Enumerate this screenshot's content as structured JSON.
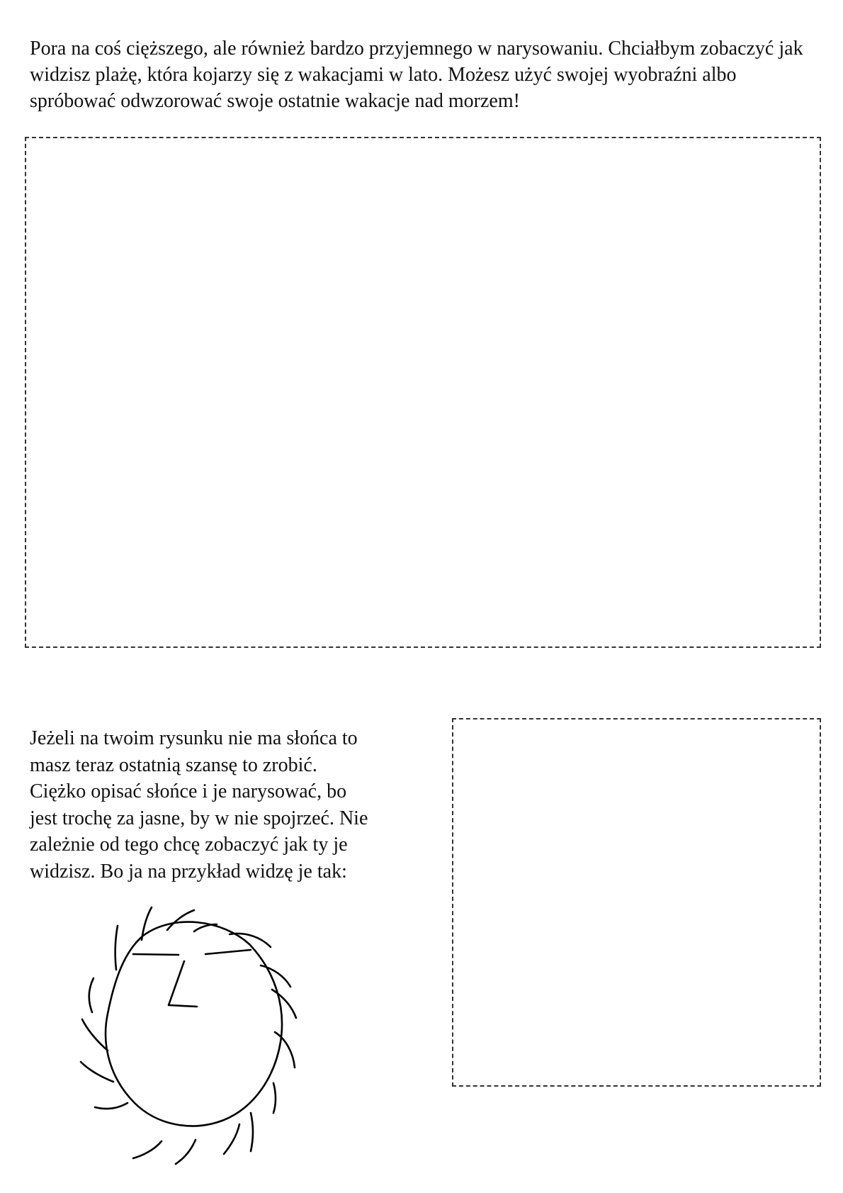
{
  "intro_text": "Pora na coś cięższego, ale również bardzo przyjemnego w narysowaniu. Chciałbym zobaczyć jak widzisz plażę, która kojarzy się z wakacjami w lato. Możesz użyć swojej wyobraźni albo spróbować odwzorować swoje ostatnie wakacje nad morzem!",
  "sun_text_lines": [
    "Jeżeli na twoim rysunku nie ma słońca to",
    "masz teraz ostatnią szansę to zrobić.",
    "Ciężko opisać słońce i je narysować, bo",
    "jest trochę za jasne, by w nie spojrzeć. Nie",
    "zależnie od tego chcę zobaczyć jak ty je",
    "widzisz. Bo ja na przykład widzę je tak:"
  ]
}
